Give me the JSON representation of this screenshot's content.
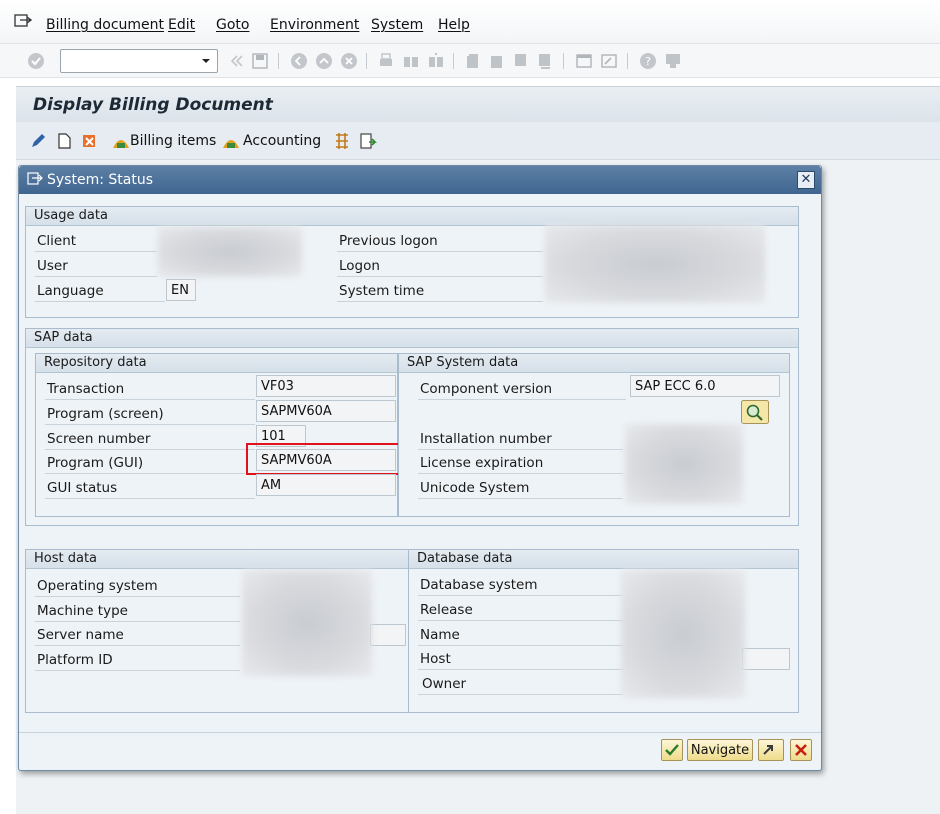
{
  "menu": [
    "Billing document",
    "Edit",
    "Goto",
    "Environment",
    "System",
    "Help"
  ],
  "screen_title": "Display Billing Document",
  "app_toolbar": {
    "billing_items": "Billing items",
    "accounting": "Accounting"
  },
  "dialog": {
    "title": "System: Status",
    "usage": {
      "header": "Usage data",
      "client_label": "Client",
      "user_label": "User",
      "language_label": "Language",
      "language_value": "EN",
      "previous_logon_label": "Previous logon",
      "logon_label": "Logon",
      "system_time_label": "System time"
    },
    "sap": {
      "header": "SAP data",
      "repo_header": "Repository data",
      "sys_header": "SAP System data",
      "transaction_label": "Transaction",
      "transaction_value": "VF03",
      "program_screen_label": "Program (screen)",
      "program_screen_value": "SAPMV60A",
      "screen_number_label": "Screen number",
      "screen_number_value": "101",
      "program_gui_label": "Program (GUI)",
      "program_gui_value": "SAPMV60A",
      "gui_status_label": "GUI status",
      "gui_status_value": "AM",
      "component_version_label": "Component version",
      "component_version_value": "SAP ECC 6.0",
      "installation_number_label": "Installation number",
      "license_expiration_label": "License expiration",
      "unicode_system_label": "Unicode System"
    },
    "host": {
      "header": "Host data",
      "os_label": "Operating system",
      "machine_label": "Machine type",
      "server_label": "Server name",
      "platform_label": "Platform ID"
    },
    "db": {
      "header": "Database data",
      "system_label": "Database system",
      "release_label": "Release",
      "name_label": "Name",
      "host_label": "Host",
      "owner_label": "Owner"
    },
    "navigate_label": "Navigate"
  }
}
